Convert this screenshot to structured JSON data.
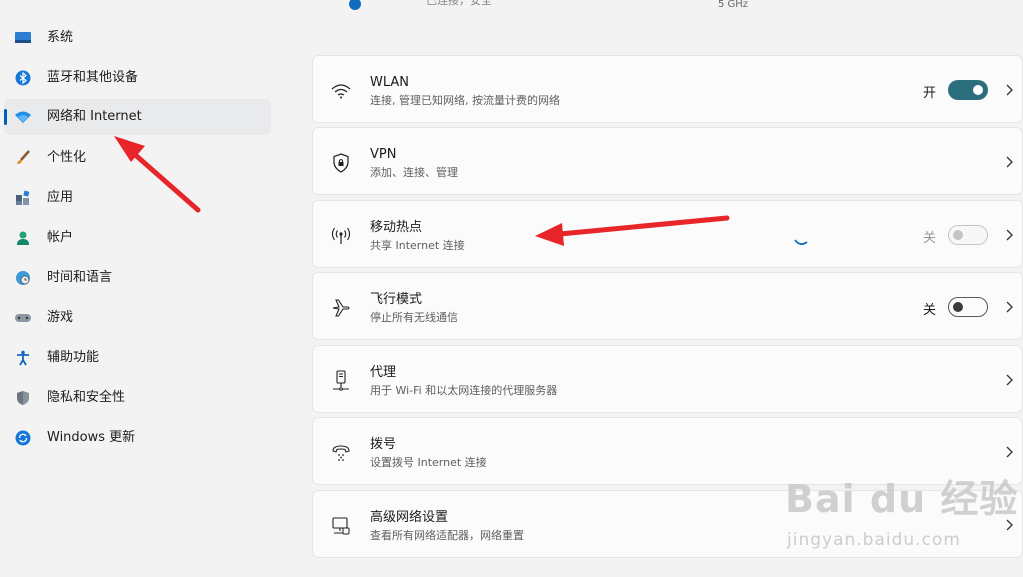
{
  "top": {
    "status": "已连接，安全",
    "band": "5 GHz"
  },
  "sidebar": {
    "items": [
      {
        "label": "系统",
        "icon": "monitor-icon"
      },
      {
        "label": "蓝牙和其他设备",
        "icon": "bluetooth-icon"
      },
      {
        "label": "网络和 Internet",
        "icon": "wifi-network-icon",
        "active": true
      },
      {
        "label": "个性化",
        "icon": "brush-icon"
      },
      {
        "label": "应用",
        "icon": "apps-icon"
      },
      {
        "label": "帐户",
        "icon": "person-icon"
      },
      {
        "label": "时间和语言",
        "icon": "globe-clock-icon"
      },
      {
        "label": "游戏",
        "icon": "gamepad-icon"
      },
      {
        "label": "辅助功能",
        "icon": "accessibility-icon"
      },
      {
        "label": "隐私和安全性",
        "icon": "shield-icon"
      },
      {
        "label": "Windows 更新",
        "icon": "sync-icon"
      }
    ]
  },
  "cards": [
    {
      "title": "WLAN",
      "subtitle": "连接, 管理已知网络, 按流量计费的网络",
      "icon": "wifi-icon",
      "toggle": {
        "label": "开",
        "state": "on"
      }
    },
    {
      "title": "VPN",
      "subtitle": "添加、连接、管理",
      "icon": "vpn-shield-icon"
    },
    {
      "title": "移动热点",
      "subtitle": "共享 Internet 连接",
      "icon": "hotspot-icon",
      "toggle": {
        "label": "关",
        "state": "disabled"
      }
    },
    {
      "title": "飞行模式",
      "subtitle": "停止所有无线通信",
      "icon": "airplane-icon",
      "toggle": {
        "label": "关",
        "state": "off"
      }
    },
    {
      "title": "代理",
      "subtitle": "用于 Wi-Fi 和以太网连接的代理服务器",
      "icon": "proxy-icon"
    },
    {
      "title": "拨号",
      "subtitle": "设置拨号 Internet 连接",
      "icon": "dialup-icon"
    },
    {
      "title": "高级网络设置",
      "subtitle": "查看所有网络适配器，网络重置",
      "icon": "network-adapter-icon"
    }
  ],
  "watermark": {
    "logo": "Bai du 经验",
    "site": "jingyan.baidu.com"
  },
  "colors": {
    "accent": "#005fb8",
    "toggle_on": "#2b6f7e",
    "arrow": "#e8262a"
  }
}
